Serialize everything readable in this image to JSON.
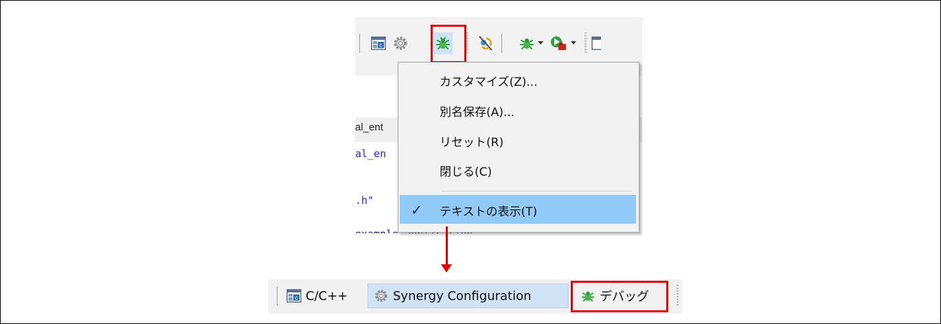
{
  "menu": {
    "items": [
      {
        "label": "カスタマイズ(Z)..."
      },
      {
        "label": "別名保存(A)..."
      },
      {
        "label": "リセット(R)"
      },
      {
        "label": "閉じる(C)"
      },
      {
        "label": "テキストの表示(T)",
        "checked": true
      }
    ]
  },
  "editor": {
    "tab_label": "al_ent",
    "code_lines": [
      "al_en",
      ".h\"",
      "example application"
    ]
  },
  "perspective_bar": {
    "items": [
      {
        "label": "C/C++",
        "icon": "c-cpp-perspective-icon"
      },
      {
        "label": "Synergy Configuration",
        "icon": "gear-icon"
      },
      {
        "label": "デバッグ",
        "icon": "bug-icon"
      }
    ]
  },
  "colors": {
    "highlight": "#e10000",
    "menu_selected": "#91c9f7",
    "bug_green": "#2e9b3a"
  }
}
